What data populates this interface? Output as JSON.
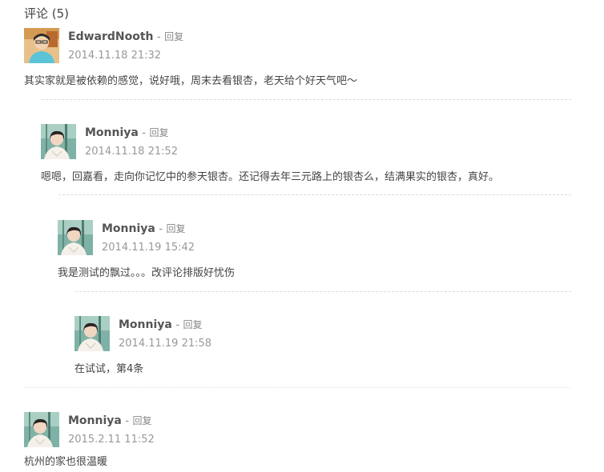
{
  "heading": "评论 (5)",
  "reply_label": "回复",
  "dash": "-",
  "comments": [
    {
      "author": "EdwardNooth",
      "date": "2014.11.18 21:32",
      "text": "其实家就是被依赖的感觉，说好哦，周末去看银杏，老天给个好天气吧～",
      "avatar": "male-avatar"
    },
    {
      "author": "Monniya",
      "date": "2014.11.18 21:52",
      "text": "嗯嗯，回嘉看，走向你记忆中的参天银杏。还记得去年三元路上的银杏么，结满果实的银杏，真好。",
      "avatar": "female-avatar"
    },
    {
      "author": "Monniya",
      "date": "2014.11.19 15:42",
      "text": "我是测试的飘过。。。改评论排版好忧伤",
      "avatar": "female-avatar"
    },
    {
      "author": "Monniya",
      "date": "2014.11.19 21:58",
      "text": "在试试，第4条",
      "avatar": "female-avatar"
    },
    {
      "author": "Monniya",
      "date": "2015.2.11 11:52",
      "text": "杭州的家也很温暖",
      "avatar": "female-avatar"
    }
  ]
}
